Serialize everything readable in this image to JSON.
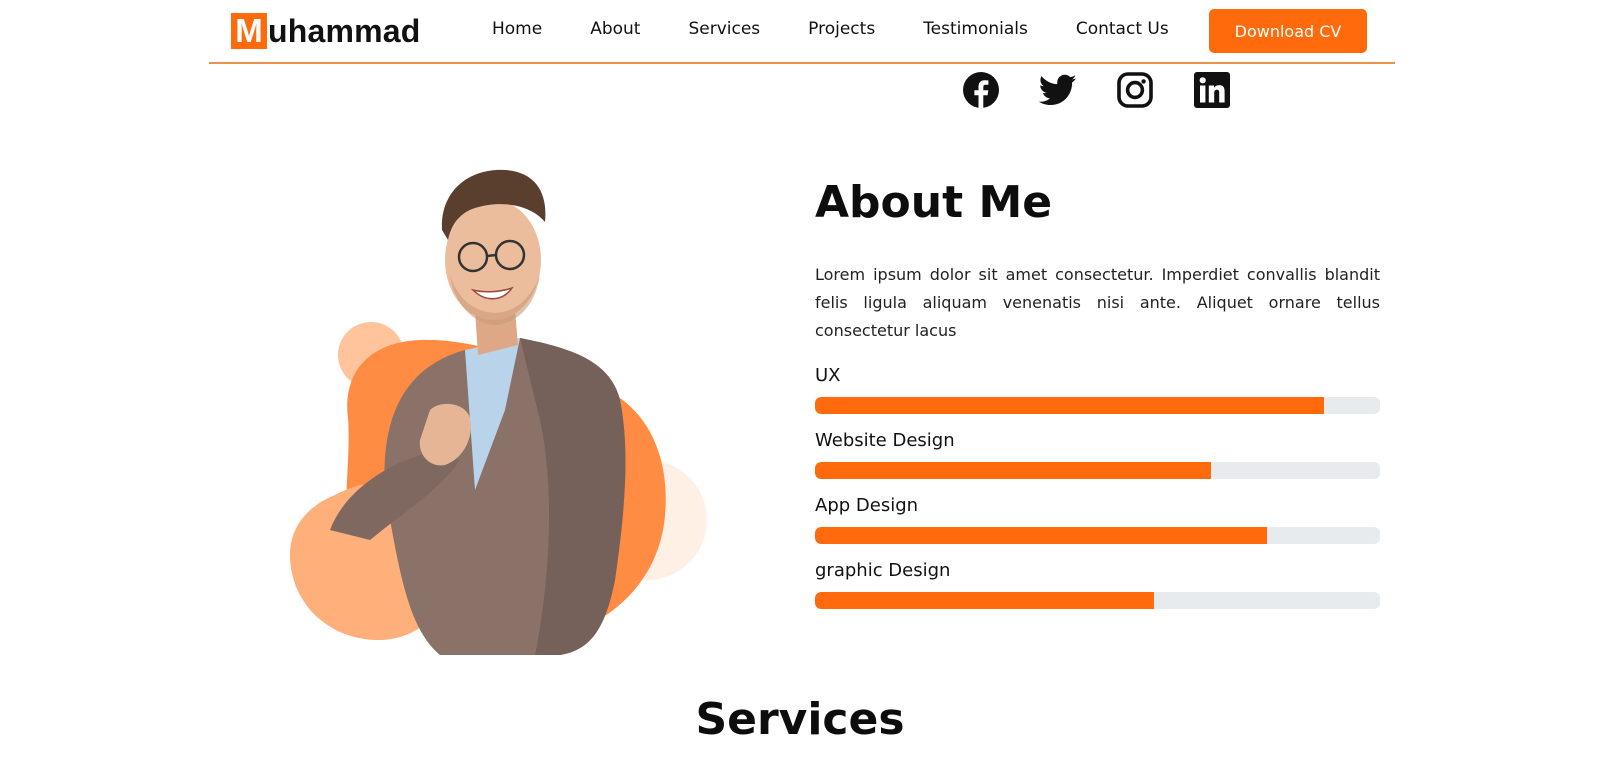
{
  "brand": {
    "initial": "M",
    "rest": "uhammad",
    "accent": "#ff6a0d"
  },
  "nav": {
    "items": [
      {
        "label": "Home"
      },
      {
        "label": "About"
      },
      {
        "label": "Services"
      },
      {
        "label": "Projects"
      },
      {
        "label": "Testimonials"
      },
      {
        "label": "Contact Us"
      }
    ],
    "cta_label": "Download CV"
  },
  "social": [
    "facebook-icon",
    "twitter-icon",
    "instagram-icon",
    "linkedin-icon"
  ],
  "about": {
    "title": "About Me",
    "text": "Lorem ipsum dolor sit amet consectetur. Imperdiet convallis blandit felis ligula aliquam venenatis nisi ante. Aliquet ornare tellus consectetur lacus",
    "skills": [
      {
        "label": "UX",
        "level": 0.9
      },
      {
        "label": "Website Design",
        "level": 0.7
      },
      {
        "label": "App Design",
        "level": 0.8
      },
      {
        "label": "graphic Design",
        "level": 0.6
      }
    ]
  },
  "services": {
    "title": "Services"
  }
}
